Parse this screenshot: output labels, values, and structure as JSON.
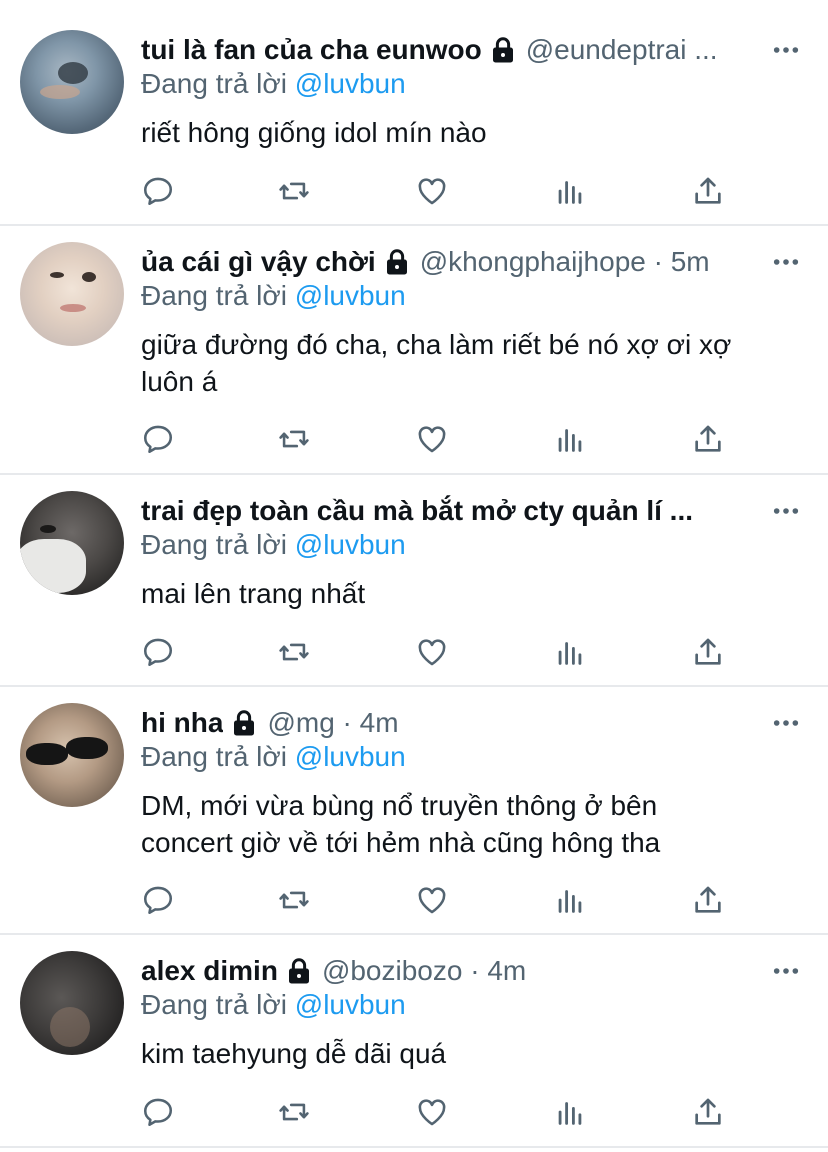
{
  "colors": {
    "text": "#0f1419",
    "muted": "#536471",
    "link": "#1d9bf0",
    "divider": "#e7e9ec"
  },
  "icons": {
    "reply": "reply-icon",
    "retweet": "retweet-icon",
    "like": "heart-icon",
    "analytics": "analytics-icon",
    "share": "share-icon",
    "more": "more-icon",
    "protected": "lock-icon"
  },
  "replies": [
    {
      "display_name": "tui là fan của cha eunwoo",
      "protected": true,
      "meta": "@eundeptrai ...",
      "replying_to_prefix": "Đang trả lời",
      "replying_to_handle": "@luvbun",
      "text": "riết hông giống idol mín nào"
    },
    {
      "display_name": "ủa cái gì vậy chời",
      "protected": true,
      "meta": "@khongphaijhope · 5m",
      "replying_to_prefix": "Đang trả lời",
      "replying_to_handle": "@luvbun",
      "text_line1": "giữa đường đó cha, cha làm riết bé nó xợ ơi xợ",
      "text_line2": "luôn á"
    },
    {
      "display_name": "trai đẹp toàn cầu mà bắt mở cty quản lí ...",
      "protected": false,
      "meta": "",
      "replying_to_prefix": "Đang trả lời",
      "replying_to_handle": "@luvbun",
      "text": "mai lên trang nhất"
    },
    {
      "display_name": "hi nha",
      "protected": true,
      "meta": "@mg · 4m",
      "replying_to_prefix": "Đang trả lời",
      "replying_to_handle": "@luvbun",
      "text_line1": "DM, mới vừa bùng nổ truyền thông ở bên",
      "text_line2": "concert giờ về tới hẻm nhà cũng hông tha"
    },
    {
      "display_name": "alex dimin",
      "protected": true,
      "meta": "@bozibozo · 4m",
      "replying_to_prefix": "Đang trả lời",
      "replying_to_handle": "@luvbun",
      "text": "kim taehyung dễ dãi quá"
    }
  ]
}
